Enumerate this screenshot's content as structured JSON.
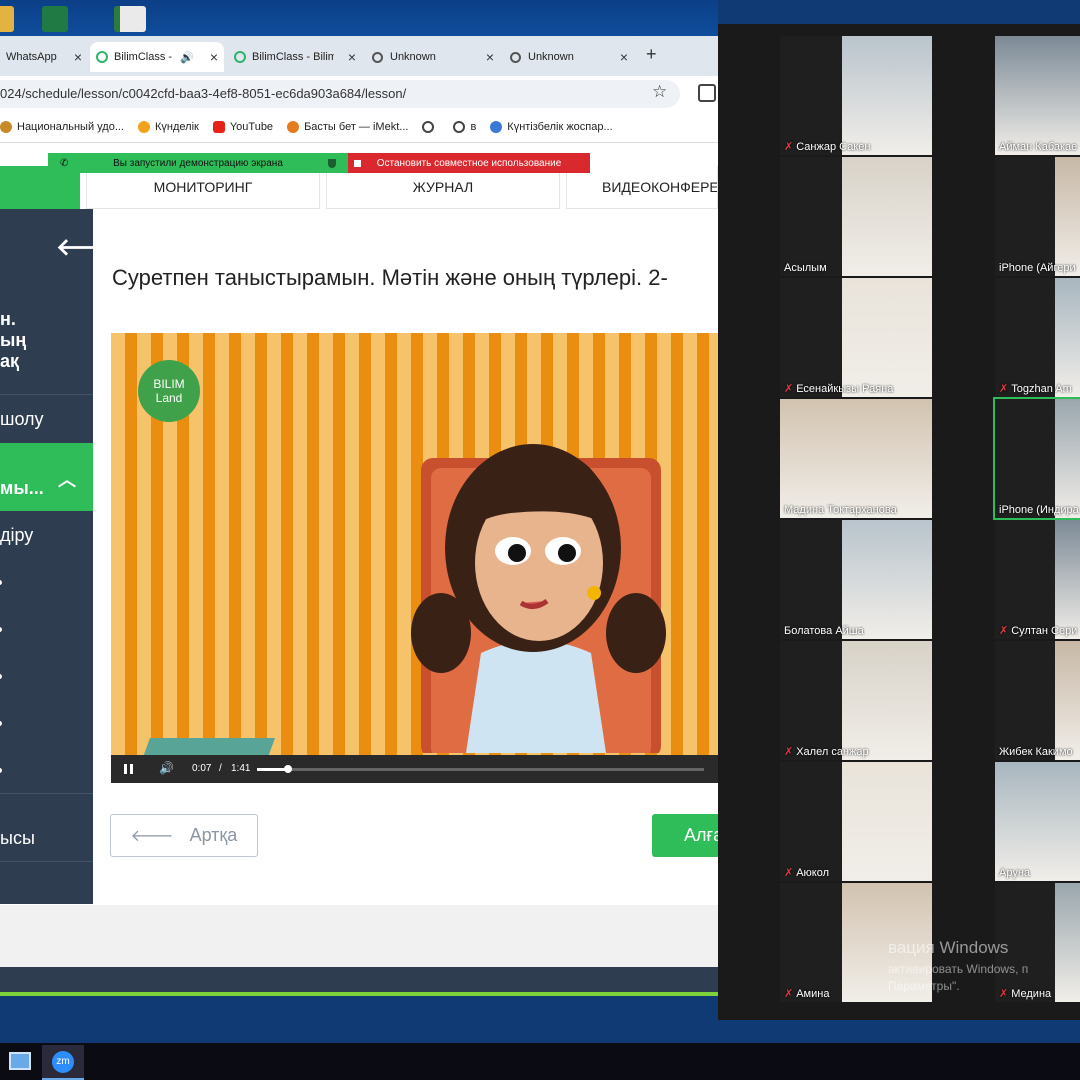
{
  "browser": {
    "tabs": [
      {
        "label": "WhatsApp",
        "active": false
      },
      {
        "label": "BilimClass -",
        "active": true
      },
      {
        "label": "BilimClass - Bilim",
        "active": false
      },
      {
        "label": "Unknown",
        "active": false
      },
      {
        "label": "Unknown",
        "active": false
      }
    ],
    "new_tab": "+",
    "url": "024/schedule/lesson/c0042cfd-baa3-4ef8-8051-ec6da903a684/lesson/",
    "bookmarks": [
      "Национальный удо...",
      "Күнделік",
      "YouTube",
      "Басты бет — iMekt...",
      "",
      "в",
      "Күнтізбелік жоспар..."
    ]
  },
  "share_banner": {
    "status": "Вы запустили демонстрацию экрана",
    "stop": "Остановить совместное использование"
  },
  "nav_tabs": [
    "МОНИТОРИНГ",
    "ЖУРНАЛ",
    "ВИДЕОКОНФЕРЕ"
  ],
  "sidebar": {
    "heading_lines": [
      "н.",
      "ың",
      "ақ"
    ],
    "items": [
      "шолу",
      "мы...",
      "діру",
      "ысы"
    ]
  },
  "lesson": {
    "title": "Суретпен таныстырамын. Мәтін және оның түрлері. 2-",
    "video": {
      "logo_line1": "BILIM",
      "logo_line2": "Land",
      "current_time": "0:07",
      "separator": "/",
      "duration": "1:41",
      "progress": 0.07
    },
    "back_button": "Артқа",
    "next_button": "Алға"
  },
  "zoom": {
    "participants": [
      {
        "name": "Санжар Сакен",
        "muted": true
      },
      {
        "name": "Айман Кабакае",
        "muted": false
      },
      {
        "name": "Асылым",
        "muted": false
      },
      {
        "name": "iPhone (Айгери",
        "muted": false
      },
      {
        "name": "Есенайкызы Раяна",
        "muted": true
      },
      {
        "name": "Togzhan Am",
        "muted": true
      },
      {
        "name": "Мадина Токтарханова",
        "muted": false
      },
      {
        "name": "iPhone (Индира",
        "muted": false
      },
      {
        "name": "Болатова Айша",
        "muted": false
      },
      {
        "name": "Султан Сери",
        "muted": true
      },
      {
        "name": "Халел санжар",
        "muted": true
      },
      {
        "name": "Жибек Какимо",
        "muted": false
      },
      {
        "name": "Аюкол",
        "muted": true
      },
      {
        "name": "Аруна",
        "muted": false
      },
      {
        "name": "Амина",
        "muted": true
      },
      {
        "name": "Медина",
        "muted": true
      }
    ]
  },
  "watermark": {
    "line1": "вация Windows",
    "line2": "активировать Windows, п",
    "line3": "Параметры\"."
  },
  "colors": {
    "accent_green": "#2ebd59",
    "sidebar": "#2e3d4f",
    "danger": "#d9292f"
  }
}
